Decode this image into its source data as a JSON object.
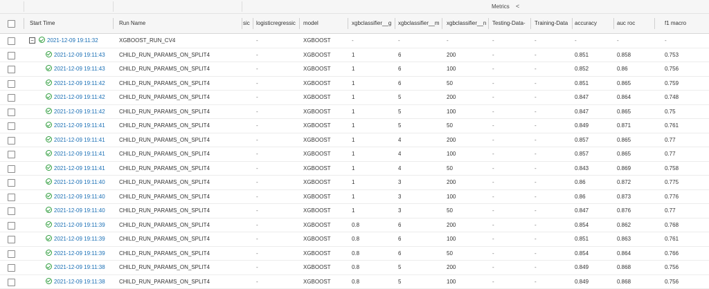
{
  "group_header": {
    "metrics_label": "Metrics",
    "collapse_glyph": "<"
  },
  "columns": {
    "start_time": "Start Time",
    "run_name": "Run Name",
    "logreg_c": "sic",
    "logreg": "logisticregressic",
    "model": "model",
    "xgb_g": "xgbclassifier__g",
    "xgb_m": "xgbclassifier__m",
    "xgb_n": "xgbclassifier__n",
    "testing": "Testing-Data-",
    "training": "Training-Data",
    "accuracy": "accuracy",
    "auc_roc": "auc roc",
    "f1_macro": "f1 macro"
  },
  "parent_run": {
    "expander": "−",
    "start_time": "2021-12-09 19:11:32",
    "run_name": "XGBOOST_RUN_CV4",
    "logreg": "-",
    "model": "XGBOOST",
    "xgb_g": "-",
    "xgb_m": "-",
    "xgb_n": "-",
    "testing": "-",
    "training": "-",
    "accuracy": "-",
    "auc_roc": "-",
    "f1_macro": "-"
  },
  "child_runs": [
    {
      "start_time": "2021-12-09 19:11:43",
      "run_name": "CHILD_RUN_PARAMS_ON_SPLIT4",
      "logreg": "-",
      "model": "XGBOOST",
      "xgb_g": "1",
      "xgb_m": "6",
      "xgb_n": "200",
      "testing": "-",
      "training": "-",
      "accuracy": "0.851",
      "auc_roc": "0.858",
      "f1_macro": "0.753"
    },
    {
      "start_time": "2021-12-09 19:11:43",
      "run_name": "CHILD_RUN_PARAMS_ON_SPLIT4",
      "logreg": "-",
      "model": "XGBOOST",
      "xgb_g": "1",
      "xgb_m": "6",
      "xgb_n": "100",
      "testing": "-",
      "training": "-",
      "accuracy": "0.852",
      "auc_roc": "0.86",
      "f1_macro": "0.756"
    },
    {
      "start_time": "2021-12-09 19:11:42",
      "run_name": "CHILD_RUN_PARAMS_ON_SPLIT4",
      "logreg": "-",
      "model": "XGBOOST",
      "xgb_g": "1",
      "xgb_m": "6",
      "xgb_n": "50",
      "testing": "-",
      "training": "-",
      "accuracy": "0.851",
      "auc_roc": "0.865",
      "f1_macro": "0.759"
    },
    {
      "start_time": "2021-12-09 19:11:42",
      "run_name": "CHILD_RUN_PARAMS_ON_SPLIT4",
      "logreg": "-",
      "model": "XGBOOST",
      "xgb_g": "1",
      "xgb_m": "5",
      "xgb_n": "200",
      "testing": "-",
      "training": "-",
      "accuracy": "0.847",
      "auc_roc": "0.864",
      "f1_macro": "0.748"
    },
    {
      "start_time": "2021-12-09 19:11:42",
      "run_name": "CHILD_RUN_PARAMS_ON_SPLIT4",
      "logreg": "-",
      "model": "XGBOOST",
      "xgb_g": "1",
      "xgb_m": "5",
      "xgb_n": "100",
      "testing": "-",
      "training": "-",
      "accuracy": "0.847",
      "auc_roc": "0.865",
      "f1_macro": "0.75"
    },
    {
      "start_time": "2021-12-09 19:11:41",
      "run_name": "CHILD_RUN_PARAMS_ON_SPLIT4",
      "logreg": "-",
      "model": "XGBOOST",
      "xgb_g": "1",
      "xgb_m": "5",
      "xgb_n": "50",
      "testing": "-",
      "training": "-",
      "accuracy": "0.849",
      "auc_roc": "0.871",
      "f1_macro": "0.761"
    },
    {
      "start_time": "2021-12-09 19:11:41",
      "run_name": "CHILD_RUN_PARAMS_ON_SPLIT4",
      "logreg": "-",
      "model": "XGBOOST",
      "xgb_g": "1",
      "xgb_m": "4",
      "xgb_n": "200",
      "testing": "-",
      "training": "-",
      "accuracy": "0.857",
      "auc_roc": "0.865",
      "f1_macro": "0.77"
    },
    {
      "start_time": "2021-12-09 19:11:41",
      "run_name": "CHILD_RUN_PARAMS_ON_SPLIT4",
      "logreg": "-",
      "model": "XGBOOST",
      "xgb_g": "1",
      "xgb_m": "4",
      "xgb_n": "100",
      "testing": "-",
      "training": "-",
      "accuracy": "0.857",
      "auc_roc": "0.865",
      "f1_macro": "0.77"
    },
    {
      "start_time": "2021-12-09 19:11:41",
      "run_name": "CHILD_RUN_PARAMS_ON_SPLIT4",
      "logreg": "-",
      "model": "XGBOOST",
      "xgb_g": "1",
      "xgb_m": "4",
      "xgb_n": "50",
      "testing": "-",
      "training": "-",
      "accuracy": "0.843",
      "auc_roc": "0.869",
      "f1_macro": "0.758"
    },
    {
      "start_time": "2021-12-09 19:11:40",
      "run_name": "CHILD_RUN_PARAMS_ON_SPLIT4",
      "logreg": "-",
      "model": "XGBOOST",
      "xgb_g": "1",
      "xgb_m": "3",
      "xgb_n": "200",
      "testing": "-",
      "training": "-",
      "accuracy": "0.86",
      "auc_roc": "0.872",
      "f1_macro": "0.775"
    },
    {
      "start_time": "2021-12-09 19:11:40",
      "run_name": "CHILD_RUN_PARAMS_ON_SPLIT4",
      "logreg": "-",
      "model": "XGBOOST",
      "xgb_g": "1",
      "xgb_m": "3",
      "xgb_n": "100",
      "testing": "-",
      "training": "-",
      "accuracy": "0.86",
      "auc_roc": "0.873",
      "f1_macro": "0.776"
    },
    {
      "start_time": "2021-12-09 19:11:40",
      "run_name": "CHILD_RUN_PARAMS_ON_SPLIT4",
      "logreg": "-",
      "model": "XGBOOST",
      "xgb_g": "1",
      "xgb_m": "3",
      "xgb_n": "50",
      "testing": "-",
      "training": "-",
      "accuracy": "0.847",
      "auc_roc": "0.876",
      "f1_macro": "0.77"
    },
    {
      "start_time": "2021-12-09 19:11:39",
      "run_name": "CHILD_RUN_PARAMS_ON_SPLIT4",
      "logreg": "-",
      "model": "XGBOOST",
      "xgb_g": "0.8",
      "xgb_m": "6",
      "xgb_n": "200",
      "testing": "-",
      "training": "-",
      "accuracy": "0.854",
      "auc_roc": "0.862",
      "f1_macro": "0.768"
    },
    {
      "start_time": "2021-12-09 19:11:39",
      "run_name": "CHILD_RUN_PARAMS_ON_SPLIT4",
      "logreg": "-",
      "model": "XGBOOST",
      "xgb_g": "0.8",
      "xgb_m": "6",
      "xgb_n": "100",
      "testing": "-",
      "training": "-",
      "accuracy": "0.851",
      "auc_roc": "0.863",
      "f1_macro": "0.761"
    },
    {
      "start_time": "2021-12-09 19:11:39",
      "run_name": "CHILD_RUN_PARAMS_ON_SPLIT4",
      "logreg": "-",
      "model": "XGBOOST",
      "xgb_g": "0.8",
      "xgb_m": "6",
      "xgb_n": "50",
      "testing": "-",
      "training": "-",
      "accuracy": "0.854",
      "auc_roc": "0.864",
      "f1_macro": "0.766"
    },
    {
      "start_time": "2021-12-09 19:11:38",
      "run_name": "CHILD_RUN_PARAMS_ON_SPLIT4",
      "logreg": "-",
      "model": "XGBOOST",
      "xgb_g": "0.8",
      "xgb_m": "5",
      "xgb_n": "200",
      "testing": "-",
      "training": "-",
      "accuracy": "0.849",
      "auc_roc": "0.868",
      "f1_macro": "0.756"
    },
    {
      "start_time": "2021-12-09 19:11:38",
      "run_name": "CHILD_RUN_PARAMS_ON_SPLIT4",
      "logreg": "-",
      "model": "XGBOOST",
      "xgb_g": "0.8",
      "xgb_m": "5",
      "xgb_n": "100",
      "testing": "-",
      "training": "-",
      "accuracy": "0.849",
      "auc_roc": "0.868",
      "f1_macro": "0.756"
    }
  ]
}
